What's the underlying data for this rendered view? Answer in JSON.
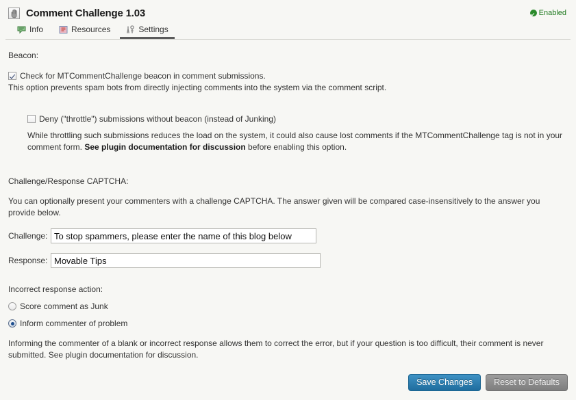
{
  "header": {
    "title": "Comment Challenge 1.03",
    "icon": "plugin-hand-icon",
    "status": "Enabled"
  },
  "tabs": [
    {
      "label": "Info",
      "icon": "comment-bubble-icon",
      "active": false
    },
    {
      "label": "Resources",
      "icon": "resources-icon",
      "active": false
    },
    {
      "label": "Settings",
      "icon": "settings-tools-icon",
      "active": true
    }
  ],
  "beacon": {
    "section_label": "Beacon:",
    "checkbox_label": "Check for MTCommentChallenge beacon in comment submissions.",
    "checkbox_checked": true,
    "description": "This option prevents spam bots from directly injecting comments into the system via the comment script.",
    "throttle_label": "Deny (\"throttle\") submissions without beacon (instead of Junking)",
    "throttle_checked": false,
    "throttle_desc_part1": "While throttling such submissions reduces the load on the system, it could also cause lost comments if the MTCommentChallenge tag is not in your comment form. ",
    "throttle_desc_bold": "See plugin documentation for discussion",
    "throttle_desc_part2": " before enabling this option."
  },
  "captcha": {
    "section_label": "Challenge/Response CAPTCHA:",
    "intro": "You can optionally present your commenters with a challenge CAPTCHA. The answer given will be compared case-insensitively to the answer you provide below.",
    "challenge_label": "Challenge:",
    "challenge_value": "To stop spammers, please enter the name of this blog below",
    "response_label": "Response:",
    "response_value": "Movable Tips"
  },
  "incorrect_response": {
    "heading": "Incorrect response action:",
    "options": [
      {
        "label": "Score comment as Junk",
        "selected": false
      },
      {
        "label": "Inform commenter of problem",
        "selected": true
      }
    ],
    "description": "Informing the commenter of a blank or incorrect response allows them to correct the error, but if your question is too difficult, their comment is never submitted. See plugin documentation for discussion."
  },
  "footer": {
    "save_label": "Save Changes",
    "reset_label": "Reset to Defaults"
  },
  "colors": {
    "page_background": "#f7f7f4",
    "status_green": "#1f7a1f",
    "primary_button": "#2a7aad",
    "secondary_button": "#8c8c8c",
    "active_tab_underline": "#5b5b5b"
  }
}
